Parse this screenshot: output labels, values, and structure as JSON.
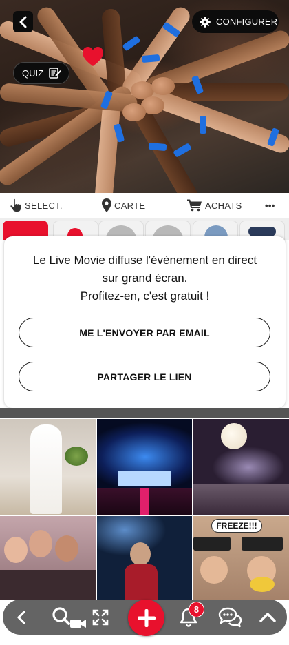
{
  "hero": {
    "configure_label": "CONFIGURER",
    "quiz_label": "QUIZ"
  },
  "menubar": {
    "select_label": "SELECT.",
    "map_label": "CARTE",
    "purchases_label": "ACHATS",
    "more_label": "•••"
  },
  "modal": {
    "line1": "Le Live Movie diffuse l'évènement en direct",
    "line2": "sur grand écran.",
    "line3": "Profitez-en, c'est gratuit !",
    "email_button": "ME L'ENVOYER PAR EMAIL",
    "share_button": "PARTAGER LE LIEN"
  },
  "grid": {
    "photos": [
      {
        "name": "bride-photo",
        "colors": [
          "#d8cfc2",
          "#f1ece6",
          "#9a8f7f"
        ]
      },
      {
        "name": "stage-concert-photo",
        "colors": [
          "#0e2a6b",
          "#2e5fd6",
          "#c2185b"
        ]
      },
      {
        "name": "balloon-party-photo",
        "colors": [
          "#2a1d2a",
          "#7a6a8a",
          "#f0e0d0"
        ]
      },
      {
        "name": "confetti-friends-photo",
        "colors": [
          "#b89aa2",
          "#f3d3c8",
          "#5a3a3a"
        ]
      },
      {
        "name": "nightclub-dance-photo",
        "colors": [
          "#10203a",
          "#3a6aa0",
          "#8a2030"
        ]
      },
      {
        "name": "freeze-photobooth-photo",
        "colors": [
          "#c9a88c",
          "#2a2a2a",
          "#f4d24a"
        ]
      }
    ],
    "freeze_text": "FREEZE!!!"
  },
  "bottombar": {
    "notification_count": "8"
  },
  "colors": {
    "accent_red": "#e8112d",
    "button_black": "#0c0c0c"
  }
}
